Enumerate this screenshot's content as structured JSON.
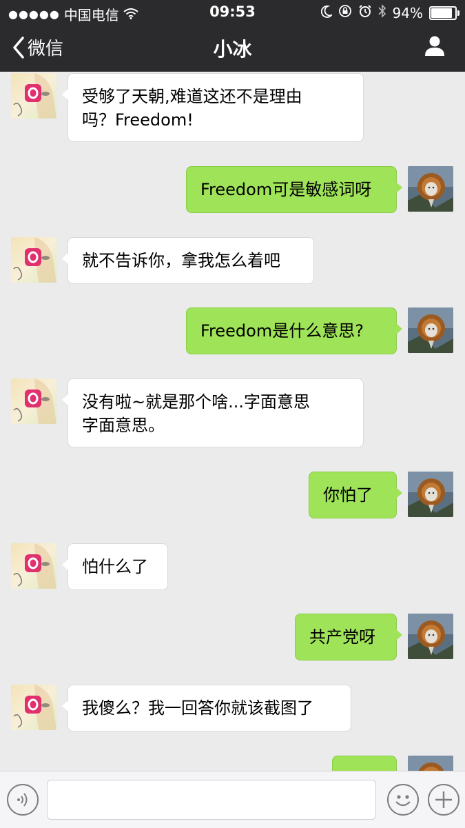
{
  "status_bar": {
    "signal_dots": "●●●●●",
    "carrier": "中国电信",
    "time": "09:53",
    "battery_percent": "94%",
    "battery_level": 0.94,
    "icons": [
      "wifi-icon",
      "moon-icon",
      "rotation-lock-icon",
      "alarm-icon",
      "bluetooth-icon",
      "battery-icon"
    ]
  },
  "nav": {
    "back_label": "微信",
    "title": "小冰",
    "profile_icon": "person-icon"
  },
  "messages": [
    {
      "side": "in",
      "lines": [
        "受够了天朝,难道这还不是理由",
        "吗？Freedom!"
      ]
    },
    {
      "side": "out",
      "lines": [
        "Freedom可是敏感词呀"
      ]
    },
    {
      "side": "in",
      "lines": [
        "就不告诉你，拿我怎么着吧"
      ]
    },
    {
      "side": "out",
      "lines": [
        "Freedom是什么意思?"
      ]
    },
    {
      "side": "in",
      "lines": [
        "没有啦~就是那个啥...字面意思",
        "字面意思。"
      ]
    },
    {
      "side": "out",
      "lines": [
        "你怕了"
      ]
    },
    {
      "side": "in",
      "lines": [
        "怕什么了"
      ]
    },
    {
      "side": "out",
      "lines": [
        "共产党呀"
      ]
    },
    {
      "side": "in",
      "lines": [
        "我傻么？我一回答你就该截图了"
      ]
    },
    {
      "side": "out",
      "lines": [
        ""
      ]
    }
  ],
  "input_bar": {
    "voice_icon": "voice-icon",
    "emoji_icon": "emoji-icon",
    "add_icon": "plus-icon"
  },
  "colors": {
    "nav_bg": "#2b2b2e",
    "chat_bg": "#ebebeb",
    "bubble_out": "#9fe358",
    "bubble_in": "#ffffff"
  }
}
